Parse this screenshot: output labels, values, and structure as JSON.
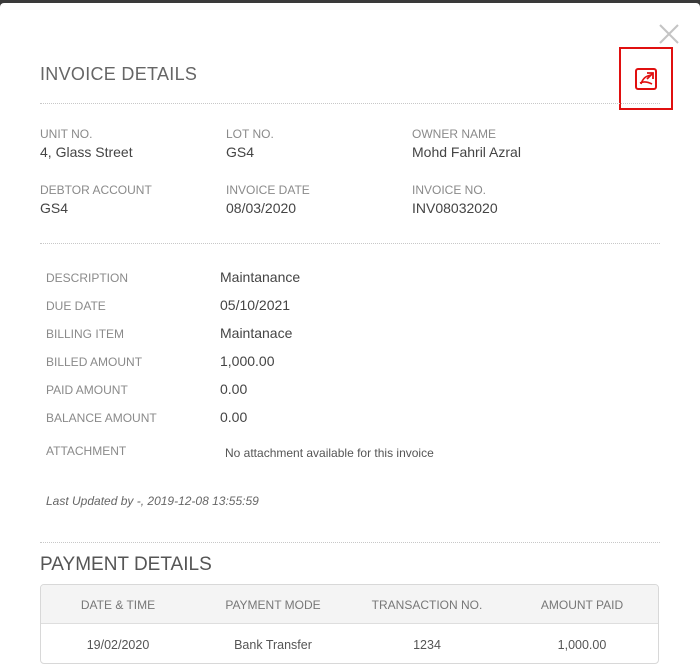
{
  "modal": {
    "title": "INVOICE DETAILS"
  },
  "icons": {
    "close": "close-icon",
    "pdf": "pdf-export-icon",
    "pdf_color": "#e01010"
  },
  "invoice": {
    "unit_no_label": "UNIT NO.",
    "unit_no": "4, Glass Street",
    "lot_no_label": "LOT NO.",
    "lot_no": "GS4",
    "owner_name_label": "OWNER NAME",
    "owner_name": "Mohd Fahril Azral",
    "debtor_account_label": "DEBTOR ACCOUNT",
    "debtor_account": "GS4",
    "invoice_date_label": "INVOICE DATE",
    "invoice_date": "08/03/2020",
    "invoice_no_label": "INVOICE NO.",
    "invoice_no": "INV08032020"
  },
  "details": {
    "description_label": "DESCRIPTION",
    "description": "Maintanance",
    "due_date_label": "DUE DATE",
    "due_date": "05/10/2021",
    "billing_item_label": "BILLING ITEM",
    "billing_item": "Maintanace",
    "billed_amount_label": "BILLED AMOUNT",
    "billed_amount": "1,000.00",
    "paid_amount_label": "PAID AMOUNT",
    "paid_amount": "0.00",
    "balance_amount_label": "BALANCE AMOUNT",
    "balance_amount": "0.00",
    "attachment_label": "ATTACHMENT",
    "attachment_note": "No attachment available for this invoice",
    "last_updated": "Last Updated by -, 2019-12-08 13:55:59"
  },
  "payments": {
    "title": "PAYMENT DETAILS",
    "columns": [
      "DATE & TIME",
      "PAYMENT MODE",
      "TRANSACTION NO.",
      "AMOUNT PAID"
    ],
    "rows": [
      {
        "date": "19/02/2020",
        "mode": "Bank Transfer",
        "transaction_no": "1234",
        "amount": "1,000.00"
      }
    ],
    "link_color": "#3a8fd6"
  }
}
